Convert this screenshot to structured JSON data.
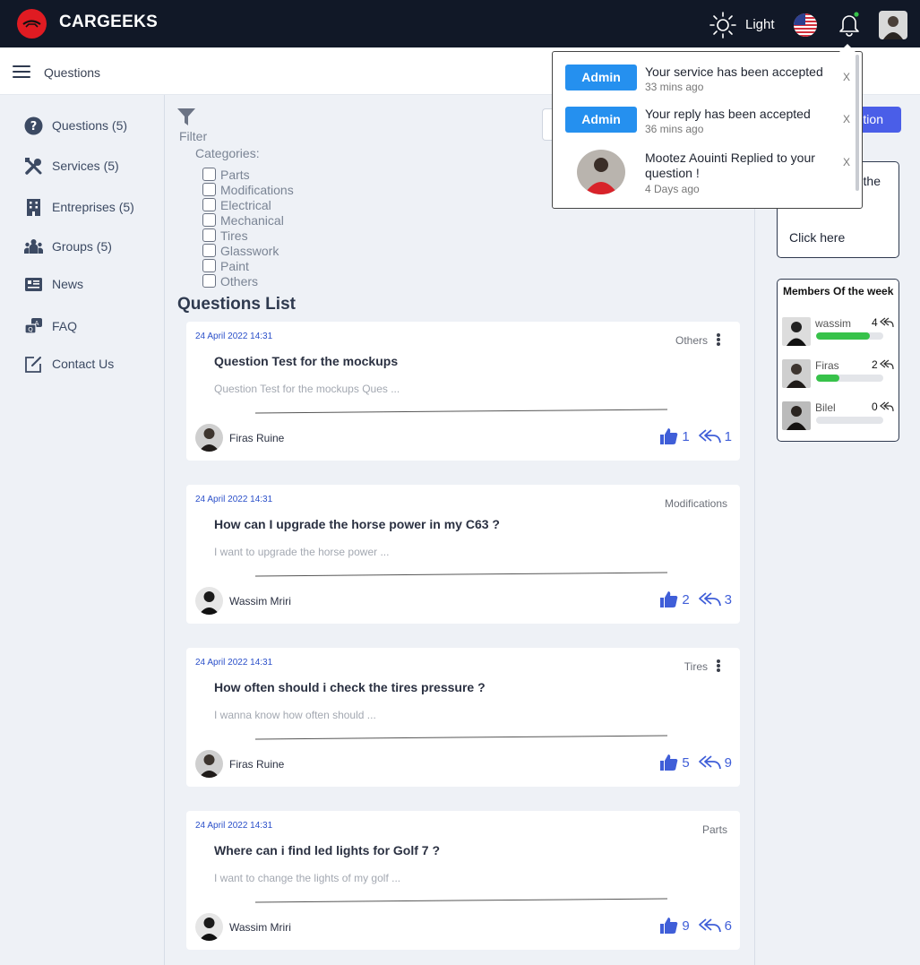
{
  "header": {
    "brand": "CARGEEKS",
    "theme_label": "Light",
    "icons": [
      "logo-icon",
      "sun-icon",
      "us-flag-icon",
      "bell-icon",
      "user-avatar"
    ]
  },
  "subheader": {
    "title": "Questions"
  },
  "sidebar": {
    "items": [
      {
        "label": "Questions (5)",
        "icon": "question-icon"
      },
      {
        "label": "Services (5)",
        "icon": "tools-icon"
      },
      {
        "label": "Entreprises (5)",
        "icon": "building-icon"
      },
      {
        "label": "Groups (5)",
        "icon": "people-icon"
      },
      {
        "label": "News",
        "icon": "newspaper-icon"
      },
      {
        "label": "FAQ",
        "icon": "faq-icon"
      },
      {
        "label": "Contact Us",
        "icon": "edit-icon"
      }
    ]
  },
  "filter": {
    "label": "Filter",
    "categories_title": "Categories:",
    "categories": [
      "Parts",
      "Modifications",
      "Electrical",
      "Mechanical",
      "Tires",
      "Glasswork",
      "Paint",
      "Others"
    ]
  },
  "questions": {
    "title": "Questions List",
    "items": [
      {
        "date": "24 April 2022 14:31",
        "category": "Others",
        "title": "Question Test for the mockups",
        "excerpt": "Question Test for the mockups Ques ...",
        "author": "Firas Ruine",
        "likes": "1",
        "replies": "1"
      },
      {
        "date": "24 April 2022 14:31",
        "category": "Modifications",
        "title": "How can I upgrade the horse power in my C63 ?",
        "excerpt": "I want to upgrade the horse power ...",
        "author": "Wassim Mriri",
        "likes": "2",
        "replies": "3"
      },
      {
        "date": "24 April 2022 14:31",
        "category": "Tires",
        "title": "How often should i check the tires pressure ?",
        "excerpt": "I wanna know how often should ...",
        "author": "Firas Ruine",
        "likes": "5",
        "replies": "9"
      },
      {
        "date": "24 April 2022 14:31",
        "category": "Parts",
        "title": "Where can i find led lights for Golf 7 ?",
        "excerpt": "I want to change the lights of my golf ...",
        "author": "Wassim Mriri",
        "likes": "9",
        "replies": "6"
      }
    ]
  },
  "right": {
    "ask_button": "tion",
    "promo_top": "the",
    "promo_link": "Click here",
    "members_title": "Members Of the week",
    "members": [
      {
        "name": "wassim",
        "points": "4",
        "progress": 0.8
      },
      {
        "name": "Firas",
        "points": "2",
        "progress": 0.35
      },
      {
        "name": "Bilel",
        "points": "0",
        "progress": 0
      }
    ]
  },
  "notifications": [
    {
      "badge": "Admin",
      "text": "Your service has been accepted",
      "time": "33 mins ago",
      "close": "X"
    },
    {
      "badge": "Admin",
      "text": "Your reply has been accepted",
      "time": "36 mins ago",
      "close": "X"
    },
    {
      "avatar": "user-avatar",
      "text": "Mootez Aouinti Replied to your question !",
      "time": "4 Days ago",
      "close": "X"
    }
  ],
  "colors": {
    "topbar": "#111827",
    "brand_red": "#e01b22",
    "accent_blue": "#4a5ee8",
    "badge_blue": "#2590ef",
    "progress_green": "#37c24a",
    "stat_blue": "#3f5ed8"
  }
}
